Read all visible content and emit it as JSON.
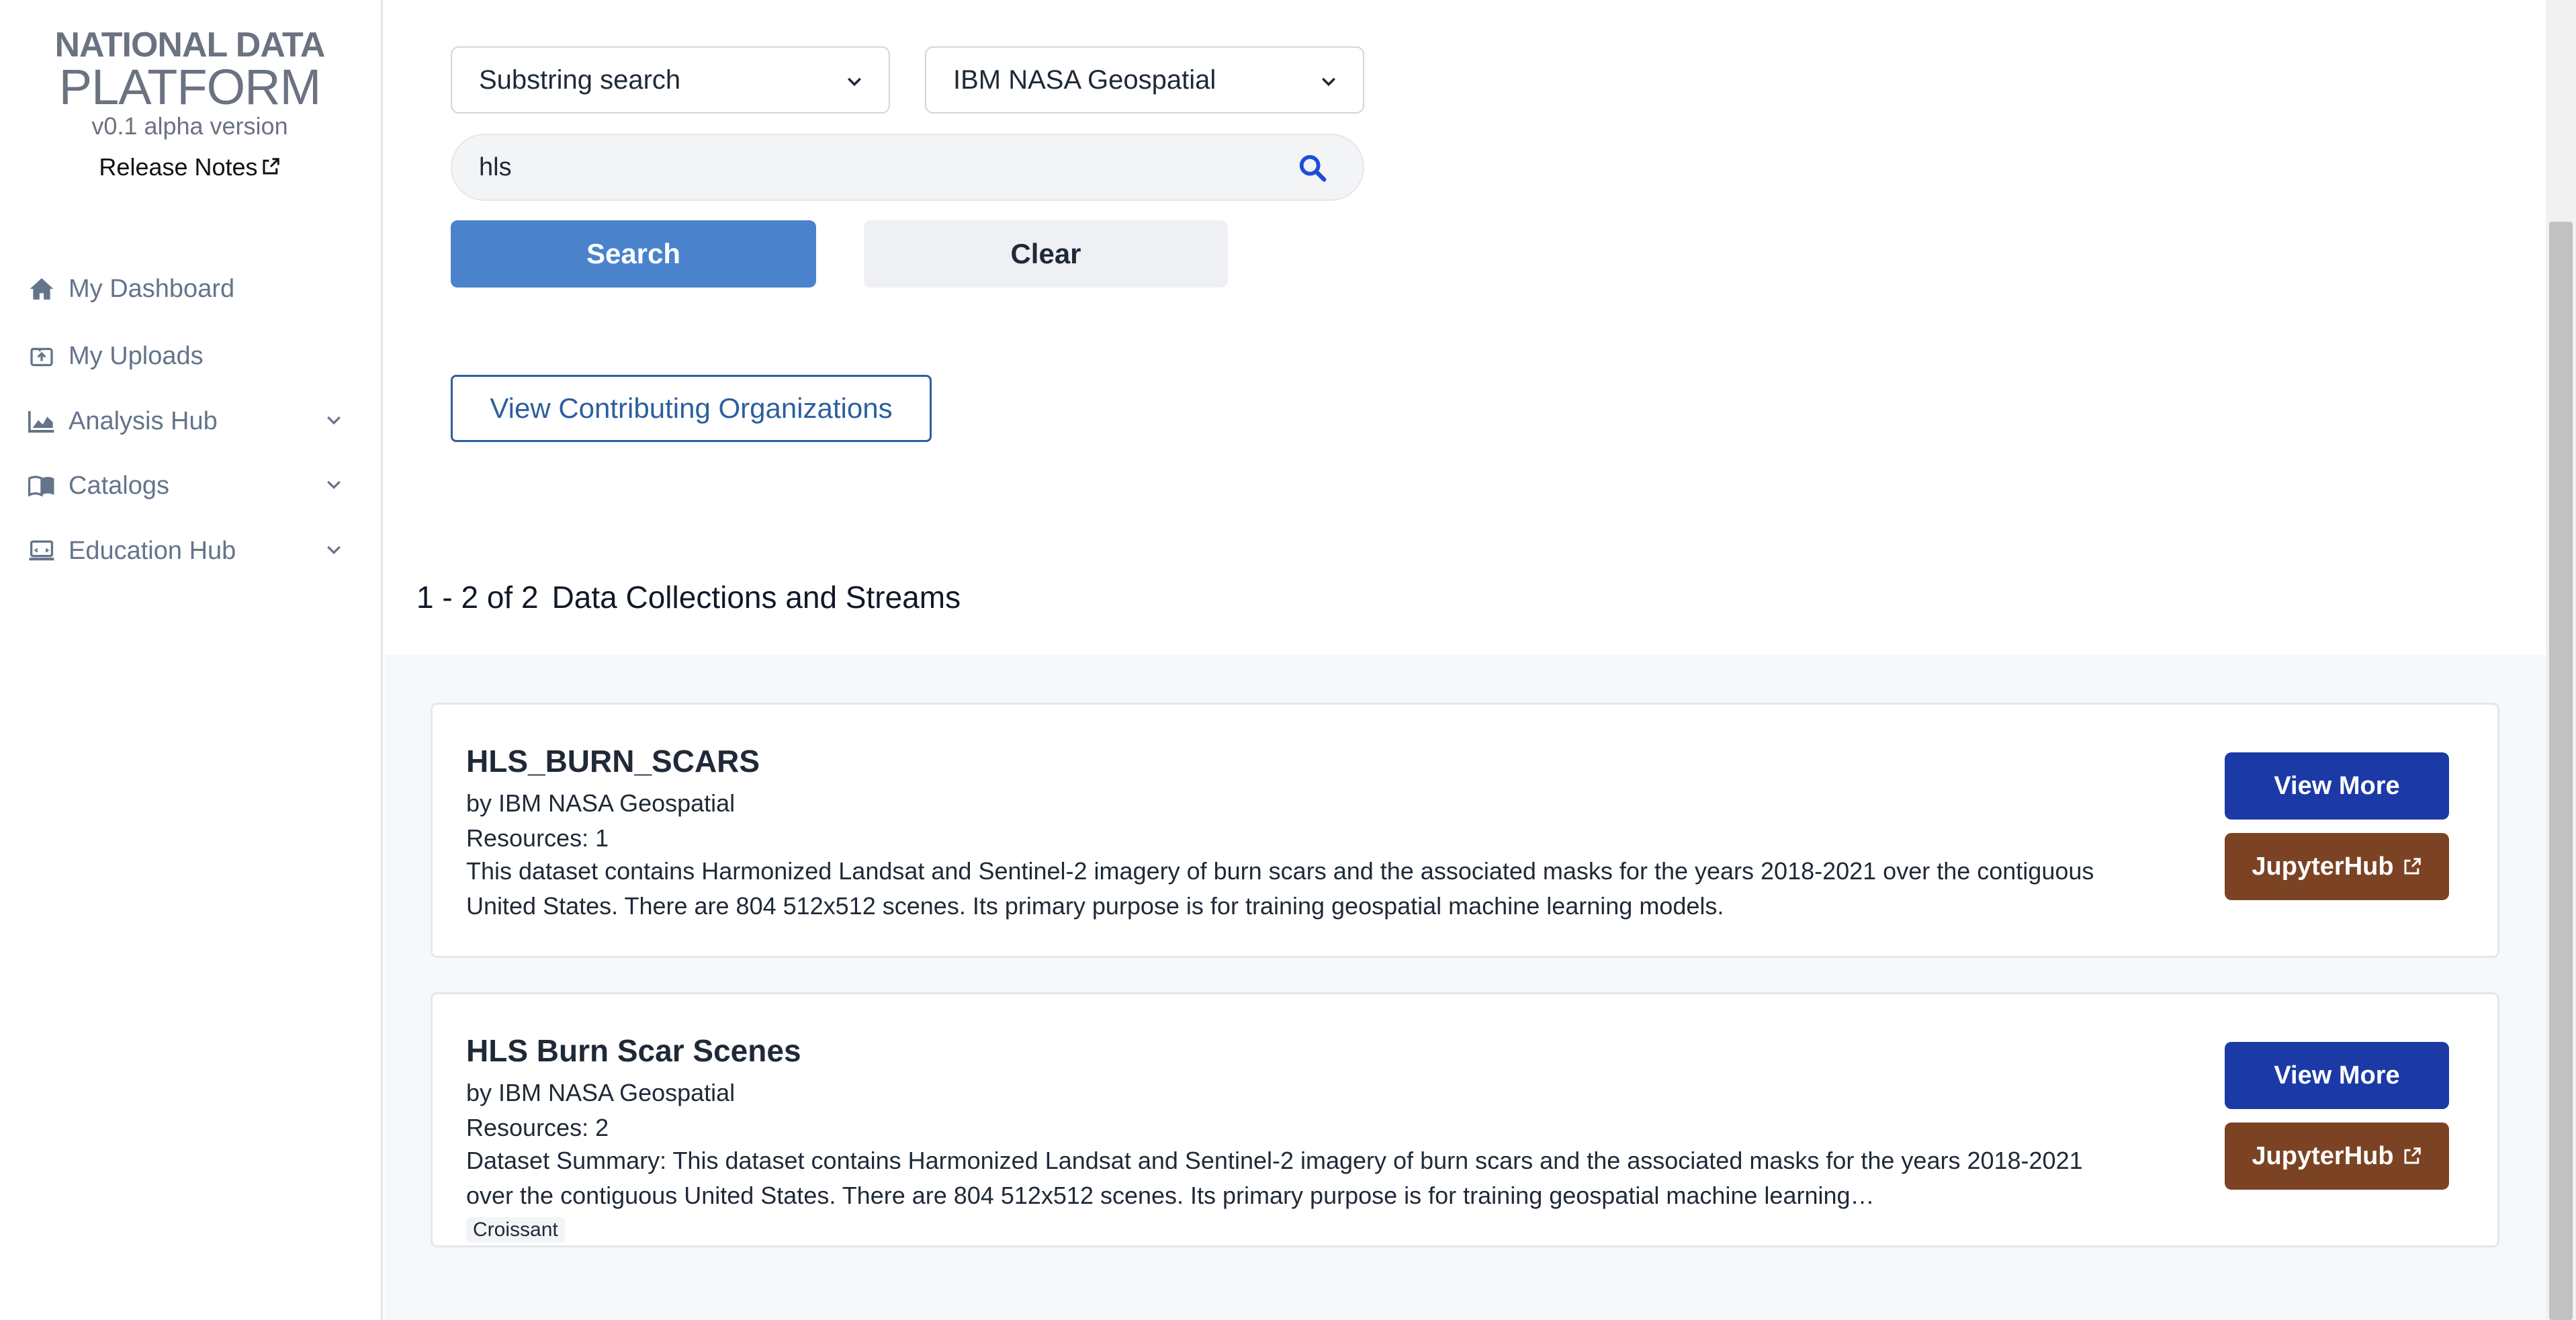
{
  "sidebar": {
    "brand_line1": "NATIONAL DATA",
    "brand_line2": "PLATFORM",
    "version": "v0.1 alpha version",
    "release_notes": "Release Notes",
    "items": [
      {
        "label": "My Dashboard",
        "icon": "home-icon",
        "expandable": false
      },
      {
        "label": "My Uploads",
        "icon": "upload-icon",
        "expandable": false
      },
      {
        "label": "Analysis Hub",
        "icon": "chart-icon",
        "expandable": true
      },
      {
        "label": "Catalogs",
        "icon": "book-icon",
        "expandable": true
      },
      {
        "label": "Education Hub",
        "icon": "laptop-icon",
        "expandable": true
      }
    ]
  },
  "search": {
    "mode": "Substring search",
    "organization": "IBM NASA Geospatial",
    "query": "hls",
    "search_label": "Search",
    "clear_label": "Clear",
    "view_orgs_label": "View Contributing Organizations"
  },
  "results": {
    "range": "1 - 2 of 2",
    "label": "Data Collections and Streams",
    "items": [
      {
        "title": "HLS_BURN_SCARS",
        "by": "by IBM NASA Geospatial",
        "resources": "Resources: 1",
        "description": "This dataset contains Harmonized Landsat and Sentinel-2 imagery of burn scars and the associated masks for the years 2018-2021 over the contiguous United States. There are 804 512x512 scenes. Its primary purpose is for training geospatial machine learning models.",
        "view_more": "View More",
        "jupyterhub": "JupyterHub"
      },
      {
        "title": "HLS Burn Scar Scenes",
        "by": "by IBM NASA Geospatial",
        "resources": "Resources: 2",
        "description": "Dataset Summary: This dataset contains Harmonized Landsat and Sentinel-2 imagery of burn scars and the associated masks for the years 2018-2021 over the contiguous United States. There are 804 512x512 scenes. Its primary purpose is for training geospatial machine learning…",
        "tag": "Croissant",
        "view_more": "View More",
        "jupyterhub": "JupyterHub"
      }
    ]
  },
  "colors": {
    "search_button": "#4a82cc",
    "view_more_button": "#1b3aa6",
    "jupyterhub_button": "#7b4324",
    "outline_button": "#2c5f9e"
  }
}
